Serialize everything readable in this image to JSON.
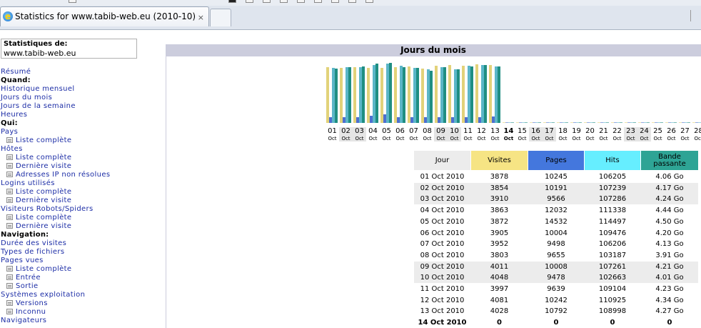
{
  "browser": {
    "tab_title": "Statistics for www.tabib-web.eu (2010-10)",
    "tab_close": "×"
  },
  "sidebar": {
    "stats_label": "Statistiques de:",
    "site": "www.tabib-web.eu",
    "items": [
      {
        "label": "Résumé",
        "type": "link"
      },
      {
        "label": "Quand:",
        "type": "head"
      },
      {
        "label": "Historique mensuel",
        "type": "link"
      },
      {
        "label": "Jours du mois",
        "type": "link"
      },
      {
        "label": "Jours de la semaine",
        "type": "link"
      },
      {
        "label": "Heures",
        "type": "link"
      },
      {
        "label": "Qui:",
        "type": "head"
      },
      {
        "label": "Pays",
        "type": "link"
      },
      {
        "label": "Liste complète",
        "type": "sub"
      },
      {
        "label": "Hôtes",
        "type": "link"
      },
      {
        "label": "Liste complète",
        "type": "sub"
      },
      {
        "label": "Dernière visite",
        "type": "sub"
      },
      {
        "label": "Adresses IP non résolues",
        "type": "sub"
      },
      {
        "label": "Logins utilisés",
        "type": "link"
      },
      {
        "label": "Liste complète",
        "type": "sub"
      },
      {
        "label": "Dernière visite",
        "type": "sub"
      },
      {
        "label": "Visiteurs Robots/Spiders",
        "type": "link"
      },
      {
        "label": "Liste complète",
        "type": "sub"
      },
      {
        "label": "Dernière visite",
        "type": "sub"
      },
      {
        "label": "Navigation:",
        "type": "head"
      },
      {
        "label": "Durée des visites",
        "type": "link"
      },
      {
        "label": "Types de fichiers",
        "type": "link"
      },
      {
        "label": "Pages vues",
        "type": "link"
      },
      {
        "label": "Liste complète",
        "type": "sub"
      },
      {
        "label": "Entrée",
        "type": "sub"
      },
      {
        "label": "Sortie",
        "type": "sub"
      },
      {
        "label": "Systèmes exploitation",
        "type": "link"
      },
      {
        "label": "Versions",
        "type": "sub"
      },
      {
        "label": "Inconnu",
        "type": "sub"
      },
      {
        "label": "Navigateurs",
        "type": "link"
      }
    ]
  },
  "panel": {
    "title": "Jours du mois"
  },
  "colors": {
    "visites": "#f6e484",
    "pages": "#4477dd",
    "hits": "#66eeff",
    "bande": "#2ea495",
    "bar_visites": "#e2d27a",
    "bar_pages": "#4e6fd0",
    "bar_hits": "#5bb6c8",
    "bar_bande": "#1f8e82"
  },
  "chart_data": {
    "type": "bar",
    "month_label": "Oct",
    "days": [
      "01",
      "02",
      "03",
      "04",
      "05",
      "06",
      "07",
      "08",
      "09",
      "10",
      "11",
      "12",
      "13",
      "14",
      "15",
      "16",
      "17",
      "18",
      "19",
      "20",
      "21",
      "22",
      "23",
      "24",
      "25",
      "26",
      "27",
      "28"
    ],
    "weekend_days": [
      "02",
      "03",
      "09",
      "10",
      "16",
      "17",
      "23",
      "24"
    ],
    "today": "14",
    "series": [
      {
        "name": "Visites",
        "values": [
          3878,
          3854,
          3910,
          3863,
          3872,
          3905,
          3952,
          3803,
          4011,
          4048,
          3997,
          4081,
          4028,
          0,
          0,
          0,
          0,
          0,
          0,
          0,
          0,
          0,
          0,
          0,
          0,
          0,
          0,
          0
        ]
      },
      {
        "name": "Pages",
        "values": [
          10245,
          10191,
          9566,
          12032,
          14532,
          10004,
          9498,
          9655,
          10008,
          9478,
          9639,
          10242,
          10792,
          0,
          0,
          0,
          0,
          0,
          0,
          0,
          0,
          0,
          0,
          0,
          0,
          0,
          0,
          0
        ]
      },
      {
        "name": "Hits",
        "values": [
          106205,
          107239,
          107286,
          111338,
          114497,
          109476,
          106206,
          103187,
          107261,
          102663,
          109104,
          110925,
          108998,
          0,
          0,
          0,
          0,
          0,
          0,
          0,
          0,
          0,
          0,
          0,
          0,
          0,
          0,
          0
        ]
      },
      {
        "name": "Bande passante",
        "values": [
          4.06,
          4.17,
          4.24,
          4.44,
          4.5,
          4.2,
          4.13,
          3.91,
          4.21,
          4.01,
          4.23,
          4.34,
          4.27,
          0,
          0,
          0,
          0,
          0,
          0,
          0,
          0,
          0,
          0,
          0,
          0,
          0,
          0,
          0
        ]
      }
    ]
  },
  "table": {
    "headers": {
      "jour": "Jour",
      "visites": "Visites",
      "pages": "Pages",
      "hits": "Hits",
      "bande": "Bande passante"
    },
    "rows": [
      {
        "jour": "01 Oct 2010",
        "visites": "3878",
        "pages": "10245",
        "hits": "106205",
        "bande": "4.06 Go"
      },
      {
        "jour": "02 Oct 2010",
        "visites": "3854",
        "pages": "10191",
        "hits": "107239",
        "bande": "4.17 Go"
      },
      {
        "jour": "03 Oct 2010",
        "visites": "3910",
        "pages": "9566",
        "hits": "107286",
        "bande": "4.24 Go"
      },
      {
        "jour": "04 Oct 2010",
        "visites": "3863",
        "pages": "12032",
        "hits": "111338",
        "bande": "4.44 Go"
      },
      {
        "jour": "05 Oct 2010",
        "visites": "3872",
        "pages": "14532",
        "hits": "114497",
        "bande": "4.50 Go"
      },
      {
        "jour": "06 Oct 2010",
        "visites": "3905",
        "pages": "10004",
        "hits": "109476",
        "bande": "4.20 Go"
      },
      {
        "jour": "07 Oct 2010",
        "visites": "3952",
        "pages": "9498",
        "hits": "106206",
        "bande": "4.13 Go"
      },
      {
        "jour": "08 Oct 2010",
        "visites": "3803",
        "pages": "9655",
        "hits": "103187",
        "bande": "3.91 Go"
      },
      {
        "jour": "09 Oct 2010",
        "visites": "4011",
        "pages": "10008",
        "hits": "107261",
        "bande": "4.21 Go"
      },
      {
        "jour": "10 Oct 2010",
        "visites": "4048",
        "pages": "9478",
        "hits": "102663",
        "bande": "4.01 Go"
      },
      {
        "jour": "11 Oct 2010",
        "visites": "3997",
        "pages": "9639",
        "hits": "109104",
        "bande": "4.23 Go"
      },
      {
        "jour": "12 Oct 2010",
        "visites": "4081",
        "pages": "10242",
        "hits": "110925",
        "bande": "4.34 Go"
      },
      {
        "jour": "13 Oct 2010",
        "visites": "4028",
        "pages": "10792",
        "hits": "108998",
        "bande": "4.27 Go"
      },
      {
        "jour": "14 Oct 2010",
        "visites": "0",
        "pages": "0",
        "hits": "0",
        "bande": "0"
      }
    ]
  }
}
